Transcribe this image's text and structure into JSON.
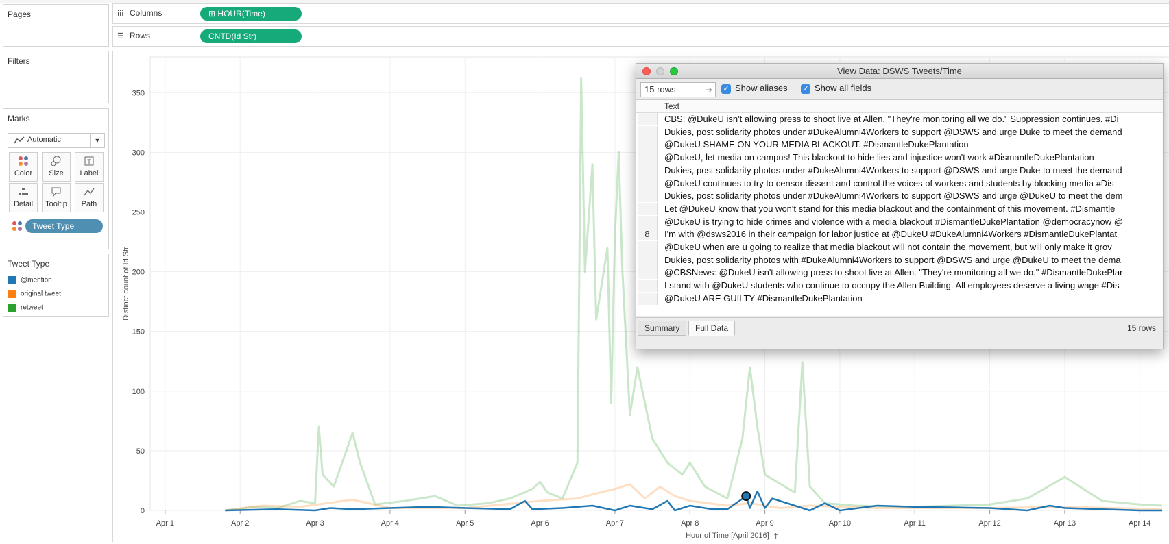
{
  "sidebar": {
    "pages_title": "Pages",
    "filters_title": "Filters",
    "marks_title": "Marks",
    "mark_type": "Automatic",
    "mark_buttons": [
      {
        "label": "Color",
        "icon": "color-icon"
      },
      {
        "label": "Size",
        "icon": "size-icon"
      },
      {
        "label": "Label",
        "icon": "label-icon"
      },
      {
        "label": "Detail",
        "icon": "detail-icon"
      },
      {
        "label": "Tooltip",
        "icon": "tooltip-icon"
      },
      {
        "label": "Path",
        "icon": "path-icon"
      }
    ],
    "color_pill": "Tweet Type",
    "legend": {
      "title": "Tweet Type",
      "items": [
        {
          "label": "@mention",
          "color": "#1f77b4"
        },
        {
          "label": "original tweet",
          "color": "#ff7f0e"
        },
        {
          "label": "retweet",
          "color": "#2ca02c"
        }
      ]
    }
  },
  "shelves": {
    "columns_label": "Columns",
    "columns_pill": "HOUR(Time)",
    "rows_label": "Rows",
    "rows_pill": "CNTD(Id Str)"
  },
  "chart_data": {
    "type": "line",
    "title": "",
    "xlabel": "Hour of Time [April 2016]",
    "ylabel": "Distinct count of Id Str",
    "x_ticks": [
      "Apr 1",
      "Apr 2",
      "Apr 3",
      "Apr 4",
      "Apr 5",
      "Apr 6",
      "Apr 7",
      "Apr 8",
      "Apr 9",
      "Apr 10",
      "Apr 11",
      "Apr 12",
      "Apr 13",
      "Apr 14"
    ],
    "y_ticks": [
      0,
      50,
      100,
      150,
      200,
      250,
      300,
      350
    ],
    "ylim": [
      0,
      380
    ],
    "grid": true,
    "series": [
      {
        "name": "retweet",
        "color": "#2ca02c",
        "opacity": 0.25,
        "values": [
          [
            1.8,
            0
          ],
          [
            2.2,
            3
          ],
          [
            2.5,
            2
          ],
          [
            2.8,
            8
          ],
          [
            3.0,
            6
          ],
          [
            3.05,
            70
          ],
          [
            3.1,
            30
          ],
          [
            3.25,
            20
          ],
          [
            3.5,
            65
          ],
          [
            3.6,
            40
          ],
          [
            3.8,
            5
          ],
          [
            4.2,
            8
          ],
          [
            4.6,
            12
          ],
          [
            4.9,
            4
          ],
          [
            5.3,
            6
          ],
          [
            5.6,
            10
          ],
          [
            5.9,
            18
          ],
          [
            6.0,
            24
          ],
          [
            6.1,
            15
          ],
          [
            6.3,
            10
          ],
          [
            6.5,
            40
          ],
          [
            6.55,
            362
          ],
          [
            6.6,
            200
          ],
          [
            6.7,
            290
          ],
          [
            6.75,
            160
          ],
          [
            6.9,
            220
          ],
          [
            6.95,
            90
          ],
          [
            7.0,
            230
          ],
          [
            7.05,
            300
          ],
          [
            7.1,
            200
          ],
          [
            7.2,
            80
          ],
          [
            7.3,
            120
          ],
          [
            7.5,
            60
          ],
          [
            7.7,
            40
          ],
          [
            7.9,
            30
          ],
          [
            8.0,
            40
          ],
          [
            8.2,
            20
          ],
          [
            8.5,
            10
          ],
          [
            8.7,
            60
          ],
          [
            8.8,
            120
          ],
          [
            8.9,
            70
          ],
          [
            9.0,
            30
          ],
          [
            9.4,
            15
          ],
          [
            9.5,
            124
          ],
          [
            9.6,
            20
          ],
          [
            9.8,
            6
          ],
          [
            10.2,
            4
          ],
          [
            11.0,
            3
          ],
          [
            12.0,
            5
          ],
          [
            12.5,
            10
          ],
          [
            13.0,
            28
          ],
          [
            13.5,
            8
          ],
          [
            14.0,
            5
          ],
          [
            14.3,
            4
          ]
        ]
      },
      {
        "name": "original tweet",
        "color": "#ff7f0e",
        "opacity": 0.25,
        "values": [
          [
            1.8,
            0
          ],
          [
            2.3,
            4
          ],
          [
            2.8,
            3
          ],
          [
            3.5,
            9
          ],
          [
            4.0,
            2
          ],
          [
            5.0,
            2
          ],
          [
            6.0,
            8
          ],
          [
            6.5,
            10
          ],
          [
            6.8,
            15
          ],
          [
            7.0,
            18
          ],
          [
            7.2,
            22
          ],
          [
            7.4,
            10
          ],
          [
            7.6,
            20
          ],
          [
            7.8,
            12
          ],
          [
            8.0,
            8
          ],
          [
            8.5,
            4
          ],
          [
            8.8,
            6
          ],
          [
            9.2,
            2
          ],
          [
            9.6,
            4
          ],
          [
            10.5,
            2
          ],
          [
            12.0,
            2
          ],
          [
            13.0,
            3
          ],
          [
            14.3,
            1
          ]
        ]
      },
      {
        "name": "@mention",
        "color": "#1f77b4",
        "opacity": 1,
        "values": [
          [
            1.8,
            0
          ],
          [
            2.5,
            1
          ],
          [
            3.0,
            0
          ],
          [
            3.2,
            2
          ],
          [
            3.5,
            1
          ],
          [
            4.0,
            2
          ],
          [
            4.5,
            3
          ],
          [
            5.0,
            2
          ],
          [
            5.6,
            1
          ],
          [
            5.8,
            8
          ],
          [
            5.9,
            1
          ],
          [
            6.3,
            2
          ],
          [
            6.7,
            4
          ],
          [
            7.0,
            0
          ],
          [
            7.2,
            4
          ],
          [
            7.5,
            1
          ],
          [
            7.7,
            8
          ],
          [
            7.8,
            0
          ],
          [
            8.0,
            4
          ],
          [
            8.3,
            1
          ],
          [
            8.5,
            1
          ],
          [
            8.75,
            12
          ],
          [
            8.8,
            2
          ],
          [
            8.9,
            16
          ],
          [
            9.0,
            2
          ],
          [
            9.1,
            10
          ],
          [
            9.6,
            0
          ],
          [
            9.8,
            6
          ],
          [
            10.0,
            0
          ],
          [
            10.5,
            4
          ],
          [
            11.0,
            3
          ],
          [
            12.0,
            2
          ],
          [
            12.5,
            0
          ],
          [
            12.8,
            4
          ],
          [
            13.0,
            2
          ],
          [
            13.5,
            1
          ],
          [
            14.0,
            0
          ],
          [
            14.3,
            0
          ]
        ]
      }
    ],
    "highlight_point": {
      "x": 8.75,
      "y": 12,
      "series": "@mention"
    }
  },
  "view_data": {
    "title": "View Data:  DSWS Tweets/Time",
    "rows_value": "15 rows",
    "show_aliases_label": "Show aliases",
    "show_all_fields_label": "Show all fields",
    "column_header": "Text",
    "rows": [
      {
        "num": "",
        "text": "CBS: @DukeU isn't allowing press to shoot live at Allen. \"They're monitoring all we do.\" Suppression continues. #Di"
      },
      {
        "num": "",
        "text": "Dukies, post solidarity photos under #DukeAlumni4Workers to support @DSWS and urge Duke to meet the demand"
      },
      {
        "num": "",
        "text": "@DukeU SHAME ON YOUR MEDIA BLACKOUT. #DismantleDukePlantation"
      },
      {
        "num": "",
        "text": "@DukeU, let media on campus! This blackout to hide lies and injustice won't work #DismantleDukePlantation"
      },
      {
        "num": "",
        "text": "Dukies, post solidarity photos under #DukeAlumni4Workers to support @DSWS and urge Duke to meet the demand"
      },
      {
        "num": "",
        "text": "@DukeU continues to try to censor dissent and control the voices of workers and students by blocking media #Dis"
      },
      {
        "num": "",
        "text": "Dukies, post solidarity photos under #DukeAlumni4Workers to support @DSWS and urge @DukeU to meet the dem"
      },
      {
        "num": "",
        "text": "Let @DukeU know that you won't stand for this media blackout and the containment of this movement. #Dismantle"
      },
      {
        "num": "",
        "text": "@DukeU is trying to hide crimes and violence with a media blackout #DismantleDukePlantation @democracynow @"
      },
      {
        "num": "8",
        "text": "I'm with @dsws2016 in their campaign for labor justice at @DukeU #DukeAlumni4Workers #DismantleDukePlantat"
      },
      {
        "num": "",
        "text": "@DukeU when are u going to realize that media blackout will not contain the movement, but will only make it grov"
      },
      {
        "num": "",
        "text": "Dukies, post solidarity photos with #DukeAlumni4Workers to support @DSWS and urge @DukeU to meet the dema"
      },
      {
        "num": "",
        "text": "@CBSNews: @DukeU isn't allowing press to shoot live at Allen. \"They're monitoring all we do.\" #DismantleDukePlar"
      },
      {
        "num": "",
        "text": "I stand with @DukeU students who continue to occupy the Allen Building. All employees deserve a living wage #Dis"
      },
      {
        "num": "",
        "text": "@DukeU ARE GUILTY #DismantleDukePlantation"
      }
    ],
    "tab_summary": "Summary",
    "tab_full_data": "Full Data",
    "row_count": "15 rows"
  }
}
